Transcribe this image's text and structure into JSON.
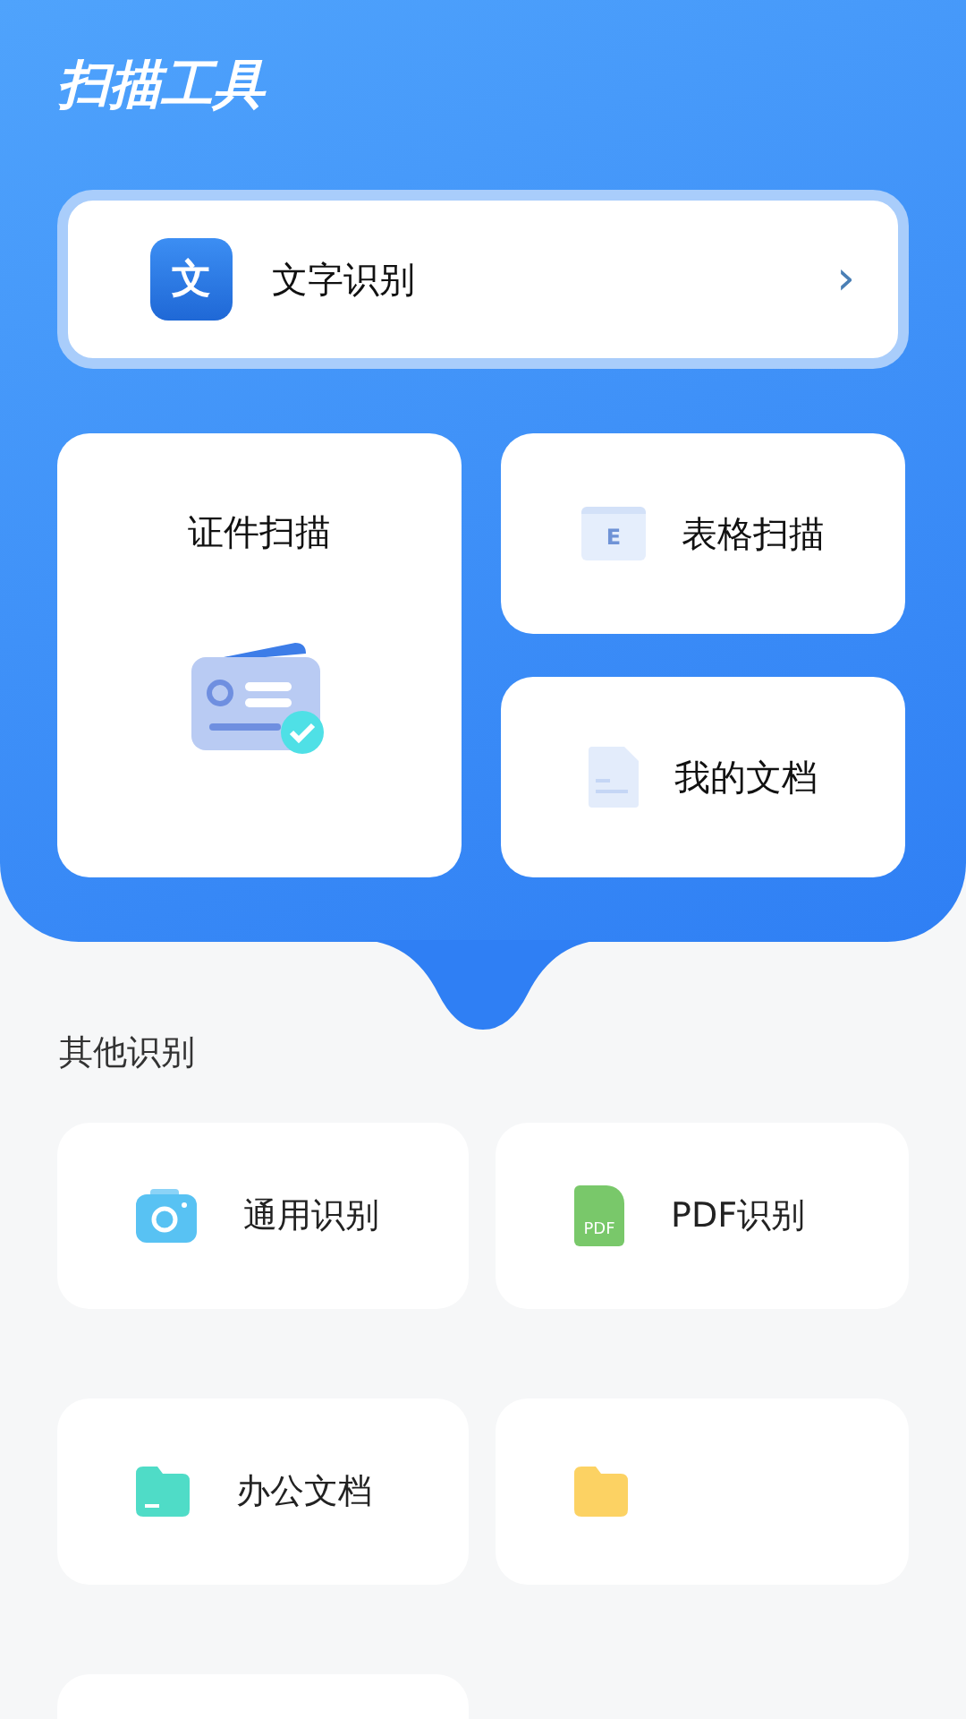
{
  "header": {
    "title": "扫描工具"
  },
  "banner": {
    "icon_text": "文",
    "label": "文字识别",
    "chevron": "›"
  },
  "tools": [
    {
      "kind": "id-card",
      "label": "证件扫描"
    },
    {
      "kind": "sheet",
      "label": "表格扫描",
      "icon_text": "E"
    },
    {
      "kind": "doc",
      "label": "我的文档"
    }
  ],
  "other": {
    "title": "其他识别",
    "items": [
      {
        "kind": "camera",
        "label": "通用识别"
      },
      {
        "kind": "pdf",
        "label": "PDF识别",
        "icon_text": "PDF"
      },
      {
        "kind": "teal-folder",
        "label": "办公文档"
      },
      {
        "kind": "yellow-folder"
      },
      {
        "kind": "blank"
      }
    ]
  }
}
